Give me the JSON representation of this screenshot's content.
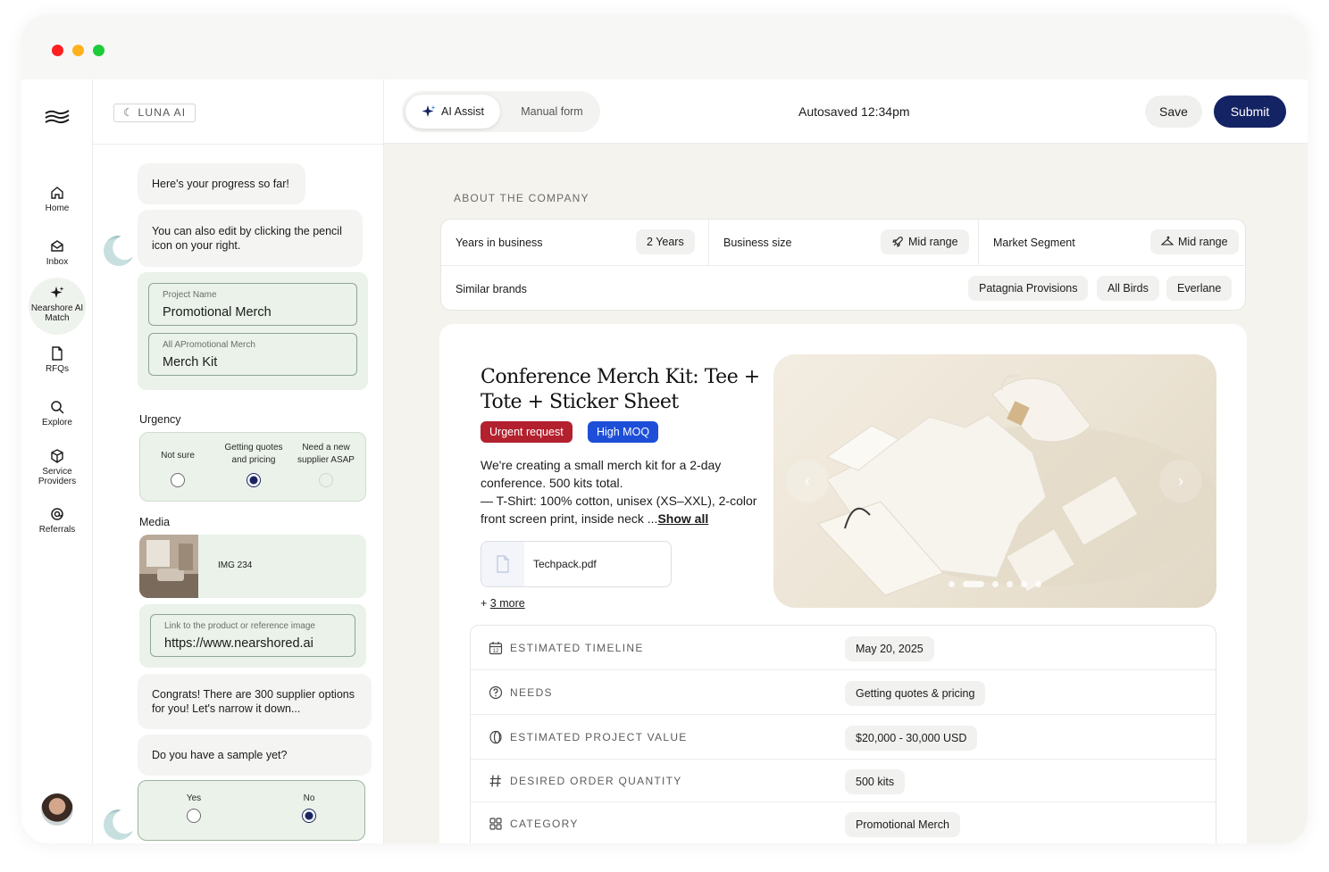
{
  "nav": {
    "items": [
      {
        "label": "Home",
        "icon": "home-icon"
      },
      {
        "label": "Inbox",
        "icon": "inbox-icon"
      },
      {
        "label": "Nearshore AI Match",
        "icon": "sparkle-icon",
        "active": true
      },
      {
        "label": "RFQs",
        "icon": "document-icon"
      },
      {
        "label": "Explore",
        "icon": "search-icon"
      },
      {
        "label": "Service Providers",
        "icon": "box-icon"
      },
      {
        "label": "Referrals",
        "icon": "referral-icon"
      }
    ]
  },
  "chat": {
    "brand": "☾ LUNA AI",
    "msg1": "Here's your progress so far!",
    "msg2": "You can also edit by clicking the pencil icon on your right.",
    "project_name_label": "Project Name",
    "project_name_value": "Promotional Merch",
    "category_label": "All APromotional Merch",
    "category_value": "Merch Kit",
    "urgency_label": "Urgency",
    "urgency_options": [
      "Not sure",
      "Getting quotes and pricing",
      "Need a new supplier ASAP"
    ],
    "urgency_selected": "Getting quotes and pricing",
    "media_label": "Media",
    "media_file": "IMG 234",
    "link_label": "Link to the product or reference image",
    "link_value": "https://www.nearshored.ai",
    "msg3": "Congrats! There are 300 supplier options for you! Let's narrow it down...",
    "msg4": "Do you have a sample yet?",
    "sample_options": [
      "Yes",
      "No"
    ],
    "sample_selected": "No"
  },
  "topbar": {
    "mode_active": "AI Assist",
    "mode_other": "Manual form",
    "autosave": "Autosaved 12:34pm",
    "save_label": "Save",
    "submit_label": "Submit"
  },
  "about": {
    "title": "ABOUT THE COMPANY",
    "years_label": "Years in business",
    "years_value": "2 Years",
    "size_label": "Business size",
    "size_value": "Mid range",
    "segment_label": "Market Segment",
    "segment_value": "Mid range",
    "brands_label": "Similar brands",
    "brands": [
      "Patagnia Provisions",
      "All Birds",
      "Everlane"
    ]
  },
  "product": {
    "title": "Conference Merch Kit: Tee + Tote + Sticker Sheet",
    "tag_urgent": "Urgent request",
    "tag_moq": "High MOQ",
    "desc_line1": "We're creating a small merch kit for a 2-day conference. 500 kits total.",
    "desc_line2": "— T-Shirt: 100% cotton, unisex (XS–XXL), 2-color front screen print, inside neck ...",
    "show_all": "Show all",
    "file_name": "Techpack.pdf",
    "more_prefix": "+ ",
    "more_link": "3 more",
    "carousel_count": 6,
    "carousel_active": 2
  },
  "details": [
    {
      "label": "ESTIMATED TIMELINE",
      "value": "May 20, 2025",
      "icon": "calendar-icon"
    },
    {
      "label": "NEEDS",
      "value": "Getting quotes & pricing",
      "icon": "question-icon"
    },
    {
      "label": "ESTIMATED PROJECT VALUE",
      "value": "$20,000  - 30,000 USD",
      "icon": "coin-icon"
    },
    {
      "label": "DESIRED ORDER QUANTITY",
      "value": "500 kits",
      "icon": "hash-icon"
    },
    {
      "label": "CATEGORY",
      "value": "Promotional Merch",
      "icon": "grid-icon"
    }
  ],
  "colors": {
    "accent": "#142364",
    "urgent": "#b3202e",
    "moq": "#1d4ed8",
    "green_card": "#eaf2e9"
  }
}
